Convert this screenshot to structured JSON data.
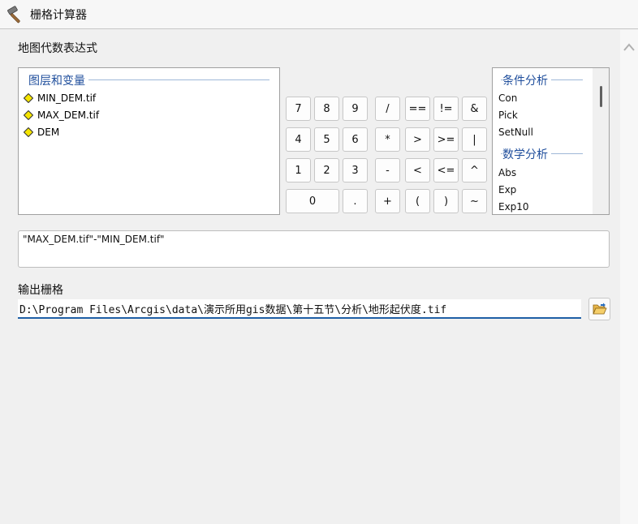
{
  "window": {
    "title": "栅格计算器",
    "app_icon": "hammer-icon"
  },
  "map_algebra": {
    "label": "地图代数表达式",
    "layers_group": {
      "title": "图层和变量",
      "items": [
        "MIN_DEM.tif",
        "MAX_DEM.tif",
        "DEM"
      ],
      "item_icon": "raster-diamond-icon",
      "icon_color": "#f5e400"
    },
    "buttons": {
      "row1": [
        "7",
        "8",
        "9",
        "/",
        "==",
        "!=",
        "&"
      ],
      "row2": [
        "4",
        "5",
        "6",
        "*",
        ">",
        ">=",
        "|"
      ],
      "row3": [
        "1",
        "2",
        "3",
        "-",
        "<",
        "<=",
        "^"
      ],
      "row4": [
        "0",
        ".",
        "+",
        "(",
        ")",
        "~"
      ]
    },
    "functions": {
      "conditional_title": "条件分析",
      "conditional_items": [
        "Con",
        "Pick",
        "SetNull"
      ],
      "math_title": "数学分析",
      "math_items": [
        "Abs",
        "Exp",
        "Exp10"
      ]
    },
    "expression": "\"MAX_DEM.tif\"-\"MIN_DEM.tif\""
  },
  "output": {
    "label": "输出栅格",
    "value": "D:\\Program Files\\Arcgis\\data\\演示所用gis数据\\第十五节\\分析\\地形起伏度.tif",
    "browse_icon": "folder-open-icon"
  },
  "colors": {
    "accent": "#1f5fa6",
    "group_title": "#1f4e9c"
  }
}
